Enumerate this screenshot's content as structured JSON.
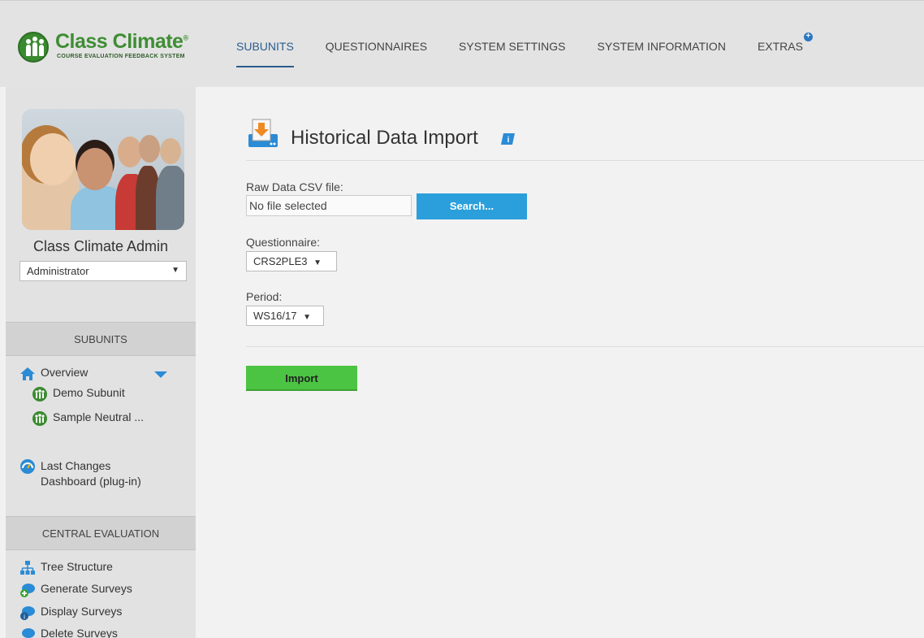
{
  "brand": {
    "name": "Class Climate",
    "trademark": "®",
    "tagline": "COURSE EVALUATION FEEDBACK SYSTEM",
    "color": "#3f8d34"
  },
  "nav": {
    "items": [
      {
        "label": "SUBUNITS",
        "active": true
      },
      {
        "label": "QUESTIONNAIRES",
        "active": false
      },
      {
        "label": "SYSTEM SETTINGS",
        "active": false
      },
      {
        "label": "SYSTEM INFORMATION",
        "active": false
      },
      {
        "label": "EXTRAS",
        "active": false
      }
    ],
    "extras_badge": "+"
  },
  "sidebar": {
    "user_name": "Class Climate Admin",
    "role": "Administrator",
    "subunits_heading": "SUBUNITS",
    "subunit_items": [
      {
        "label": "Overview",
        "icon": "home-icon"
      },
      {
        "label": "Demo Subunit",
        "icon": "people-icon"
      },
      {
        "label": "Sample Neutral ...",
        "icon": "people-icon"
      }
    ],
    "last_changes_line1": "Last Changes",
    "last_changes_line2": "Dashboard (plug-in)",
    "central_heading": "CENTRAL EVALUATION",
    "central_items": [
      {
        "label": "Tree Structure",
        "icon": "tree-icon"
      },
      {
        "label": "Generate Surveys",
        "icon": "generate-survey-icon"
      },
      {
        "label": "Display Surveys",
        "icon": "display-survey-icon"
      },
      {
        "label": "Delete Surveys",
        "icon": "delete-survey-icon"
      }
    ]
  },
  "main": {
    "title": "Historical Data Import",
    "csv_label": "Raw Data CSV file:",
    "csv_value": "No file selected",
    "search_button": "Search...",
    "questionnaire_label": "Questionnaire:",
    "questionnaire_value": "CRS2PLE3",
    "period_label": "Period:",
    "period_value": "WS16/17",
    "import_button": "Import"
  },
  "colors": {
    "accent_blue": "#2b9fdb",
    "nav_active": "#2a5d8f",
    "import_green": "#4cc443"
  }
}
